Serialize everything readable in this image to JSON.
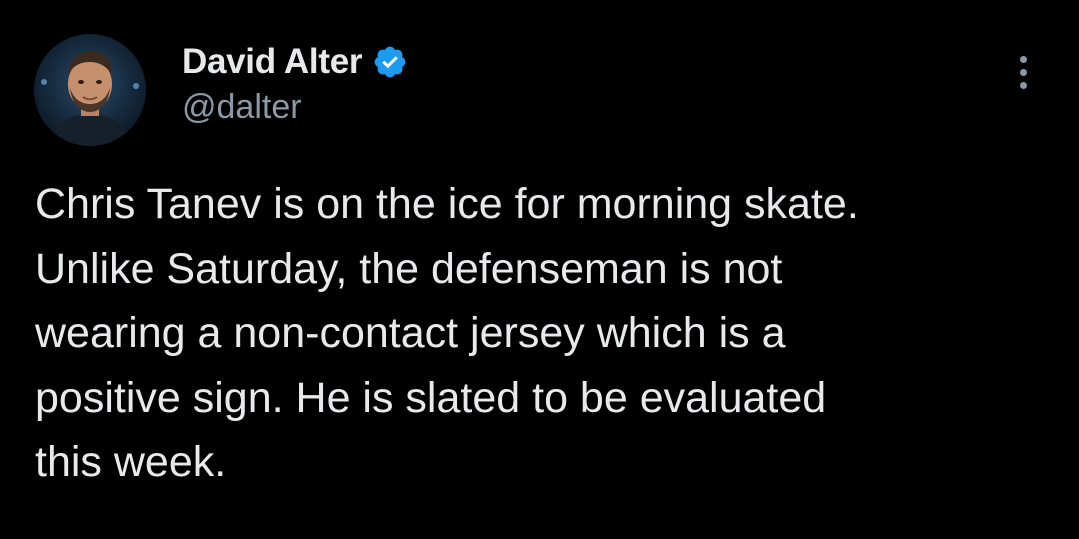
{
  "author": {
    "display_name": "David Alter",
    "handle": "@dalter",
    "verified": true,
    "avatar_icon": "profile-photo",
    "verified_icon": "verified-badge-icon"
  },
  "tweet": {
    "text": "Chris Tanev is on the ice for morning skate.\nUnlike Saturday, the defenseman is not\nwearing a non-contact jersey which is a\npositive sign. He is slated to be evaluated\nthis week."
  },
  "menu": {
    "icon": "more-options-icon"
  },
  "colors": {
    "background": "#000000",
    "primary_text": "#e7e9ea",
    "secondary_text": "#8b98a5",
    "verified_blue": "#1d9bf0"
  }
}
